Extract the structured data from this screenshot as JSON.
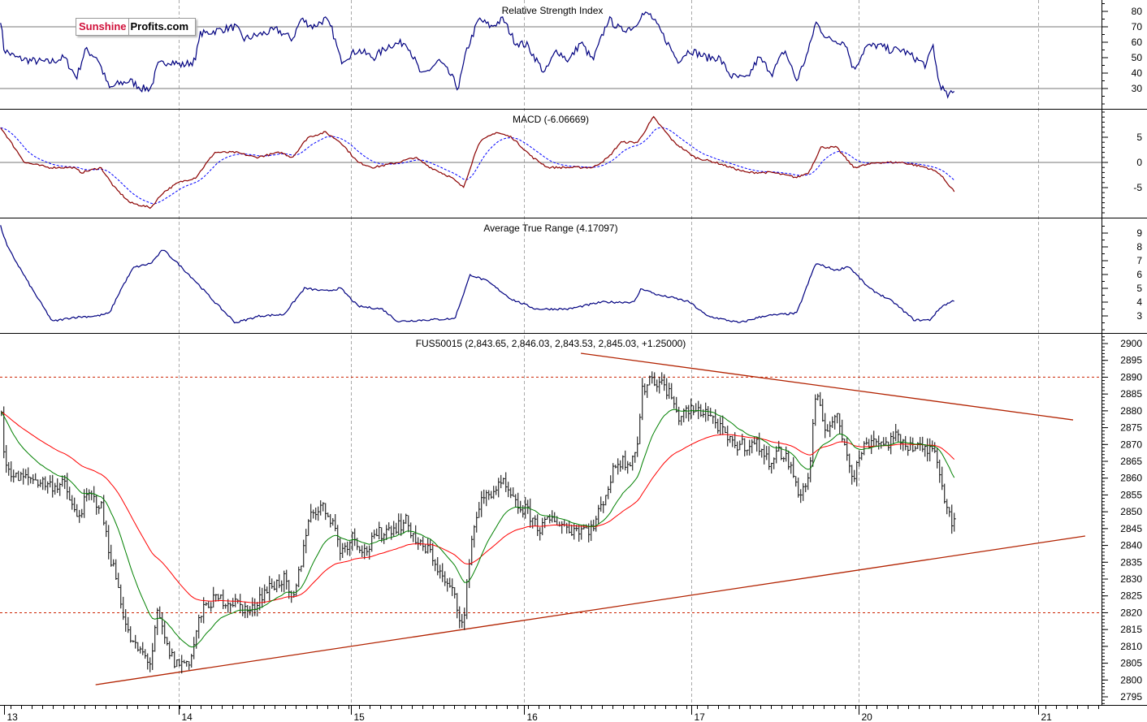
{
  "logo": {
    "part1": "Sunshine",
    "part2": "Profits.com"
  },
  "colors": {
    "price": "#000000",
    "ma_fast": "#008000",
    "ma_slow": "#ff0000",
    "indicator": "#000080",
    "macd": "#8b0000",
    "signal": "#0000ff",
    "trendline": "#b22200",
    "level": "#cc2200",
    "grid": "#aaaaaa"
  },
  "chart_data": [
    {
      "type": "line",
      "title": "Relative Strength Index",
      "ylim": [
        20,
        85
      ],
      "yticks": [
        80,
        70,
        60,
        50,
        40,
        30
      ],
      "reference_lines": [
        70,
        30
      ],
      "points": [
        [
          -0.02,
          75
        ],
        [
          0,
          55
        ],
        [
          0.07,
          50
        ],
        [
          0.16,
          48
        ],
        [
          0.26,
          47
        ],
        [
          0.35,
          50
        ],
        [
          0.42,
          37
        ],
        [
          0.47,
          55
        ],
        [
          0.54,
          50
        ],
        [
          0.61,
          30
        ],
        [
          0.66,
          33
        ],
        [
          0.73,
          35
        ],
        [
          0.8,
          30
        ],
        [
          0.85,
          30
        ],
        [
          0.89,
          45
        ],
        [
          0.96,
          48
        ],
        [
          1.03,
          45
        ],
        [
          1.11,
          48
        ],
        [
          1.13,
          65
        ],
        [
          1.25,
          68
        ],
        [
          1.34,
          70
        ],
        [
          1.39,
          62
        ],
        [
          1.48,
          65
        ],
        [
          1.58,
          68
        ],
        [
          1.67,
          62
        ],
        [
          1.72,
          75
        ],
        [
          1.79,
          70
        ],
        [
          1.86,
          75
        ],
        [
          1.9,
          68
        ],
        [
          1.95,
          48
        ],
        [
          2.05,
          55
        ],
        [
          2.14,
          50
        ],
        [
          2.23,
          58
        ],
        [
          2.33,
          60
        ],
        [
          2.38,
          48
        ],
        [
          2.42,
          38
        ],
        [
          2.52,
          48
        ],
        [
          2.59,
          38
        ],
        [
          2.63,
          30
        ],
        [
          2.68,
          55
        ],
        [
          2.75,
          75
        ],
        [
          2.82,
          70
        ],
        [
          2.89,
          75
        ],
        [
          2.96,
          60
        ],
        [
          3.03,
          58
        ],
        [
          3.13,
          40
        ],
        [
          3.2,
          55
        ],
        [
          3.27,
          48
        ],
        [
          3.34,
          60
        ],
        [
          3.41,
          48
        ],
        [
          3.5,
          75
        ],
        [
          3.57,
          68
        ],
        [
          3.65,
          70
        ],
        [
          3.69,
          78
        ],
        [
          3.74,
          78
        ],
        [
          3.83,
          62
        ],
        [
          3.9,
          48
        ],
        [
          3.97,
          55
        ],
        [
          4.07,
          50
        ],
        [
          4.14,
          50
        ],
        [
          4.21,
          38
        ],
        [
          4.3,
          36
        ],
        [
          4.37,
          50
        ],
        [
          4.45,
          40
        ],
        [
          4.52,
          55
        ],
        [
          4.59,
          35
        ],
        [
          4.66,
          55
        ],
        [
          4.7,
          73
        ],
        [
          4.77,
          62
        ],
        [
          4.87,
          60
        ],
        [
          4.92,
          42
        ],
        [
          4.99,
          57
        ],
        [
          5.06,
          58
        ],
        [
          5.13,
          55
        ],
        [
          5.2,
          55
        ],
        [
          5.27,
          50
        ],
        [
          5.34,
          45
        ],
        [
          5.38,
          58
        ],
        [
          5.41,
          35
        ],
        [
          5.46,
          25
        ],
        [
          5.51,
          28
        ]
      ]
    },
    {
      "type": "line",
      "title": "MACD (-6.06669)",
      "ylim": [
        -10,
        10
      ],
      "yticks": [
        5,
        0,
        -5
      ],
      "reference_lines": [
        0
      ],
      "series": [
        {
          "name": "MACD"
        },
        {
          "name": "Signal"
        }
      ],
      "points": [
        [
          -0.02,
          7
        ],
        [
          0.02,
          5
        ],
        [
          0.12,
          0
        ],
        [
          0.26,
          -1
        ],
        [
          0.4,
          -1
        ],
        [
          0.45,
          -2
        ],
        [
          0.56,
          -1
        ],
        [
          0.64,
          -5
        ],
        [
          0.73,
          -8
        ],
        [
          0.85,
          -9
        ],
        [
          0.92,
          -6
        ],
        [
          1.01,
          -4
        ],
        [
          1.11,
          -3
        ],
        [
          1.22,
          2
        ],
        [
          1.34,
          2
        ],
        [
          1.46,
          1
        ],
        [
          1.6,
          2
        ],
        [
          1.67,
          1
        ],
        [
          1.76,
          5
        ],
        [
          1.86,
          6
        ],
        [
          1.95,
          4
        ],
        [
          2.05,
          0
        ],
        [
          2.14,
          -1
        ],
        [
          2.28,
          0
        ],
        [
          2.38,
          1
        ],
        [
          2.47,
          -1
        ],
        [
          2.59,
          -3
        ],
        [
          2.66,
          -5
        ],
        [
          2.75,
          4
        ],
        [
          2.85,
          6
        ],
        [
          2.94,
          5
        ],
        [
          3.06,
          1
        ],
        [
          3.15,
          -1
        ],
        [
          3.27,
          -1
        ],
        [
          3.41,
          -1
        ],
        [
          3.5,
          1
        ],
        [
          3.57,
          4
        ],
        [
          3.67,
          4
        ],
        [
          3.76,
          9
        ],
        [
          3.88,
          4
        ],
        [
          4.0,
          1
        ],
        [
          4.12,
          0
        ],
        [
          4.21,
          -1
        ],
        [
          4.3,
          -2
        ],
        [
          4.45,
          -2
        ],
        [
          4.59,
          -3
        ],
        [
          4.66,
          -2
        ],
        [
          4.73,
          3
        ],
        [
          4.82,
          3
        ],
        [
          4.92,
          -1
        ],
        [
          5.06,
          0
        ],
        [
          5.2,
          0
        ],
        [
          5.34,
          -1
        ],
        [
          5.41,
          -2
        ],
        [
          5.46,
          -4
        ],
        [
          5.51,
          -6.07
        ]
      ]
    },
    {
      "type": "line",
      "title": "Average True Range (4.17097)",
      "ylim": [
        2,
        10
      ],
      "yticks": [
        9,
        8,
        7,
        6,
        5,
        4,
        3
      ],
      "points": [
        [
          -0.02,
          9.5
        ],
        [
          0.02,
          8
        ],
        [
          0.16,
          5
        ],
        [
          0.28,
          2.6
        ],
        [
          0.4,
          2.9
        ],
        [
          0.54,
          3.0
        ],
        [
          0.61,
          3.2
        ],
        [
          0.68,
          5
        ],
        [
          0.75,
          6.5
        ],
        [
          0.85,
          6.8
        ],
        [
          0.92,
          7.8
        ],
        [
          0.99,
          7
        ],
        [
          1.11,
          5.5
        ],
        [
          1.22,
          4
        ],
        [
          1.34,
          2.5
        ],
        [
          1.48,
          3
        ],
        [
          1.62,
          3.1
        ],
        [
          1.74,
          5
        ],
        [
          1.86,
          4.8
        ],
        [
          1.95,
          5
        ],
        [
          2.05,
          3.7
        ],
        [
          2.19,
          3.5
        ],
        [
          2.28,
          2.6
        ],
        [
          2.42,
          2.7
        ],
        [
          2.61,
          2.8
        ],
        [
          2.7,
          6
        ],
        [
          2.8,
          5.5
        ],
        [
          2.94,
          4.2
        ],
        [
          3.08,
          3.5
        ],
        [
          3.27,
          3.5
        ],
        [
          3.46,
          4.0
        ],
        [
          3.65,
          4.0
        ],
        [
          3.69,
          5
        ],
        [
          3.79,
          4.5
        ],
        [
          3.88,
          4.3
        ],
        [
          3.97,
          4.0
        ],
        [
          4.07,
          3.0
        ],
        [
          4.26,
          2.5
        ],
        [
          4.4,
          3.0
        ],
        [
          4.59,
          3.2
        ],
        [
          4.7,
          6.8
        ],
        [
          4.82,
          6.3
        ],
        [
          4.89,
          6.6
        ],
        [
          5.01,
          5.0
        ],
        [
          5.15,
          4
        ],
        [
          5.27,
          2.7
        ],
        [
          5.36,
          2.7
        ],
        [
          5.43,
          3.7
        ],
        [
          5.51,
          4.17
        ]
      ]
    },
    {
      "type": "bar",
      "subtype": "ohlc",
      "title": "FUS50015 (2,843.65, 2,846.03, 2,843.53, 2,845.03, +1.25000)",
      "ylim": [
        2792,
        2903
      ],
      "yticks": [
        2900,
        2895,
        2890,
        2885,
        2880,
        2875,
        2870,
        2865,
        2860,
        2855,
        2850,
        2845,
        2840,
        2835,
        2830,
        2825,
        2820,
        2815,
        2810,
        2805,
        2800,
        2795
      ],
      "horizontal_levels": [
        2890,
        2820
      ],
      "trendlines": [
        {
          "name": "resistance",
          "from": [
            3.34,
            2897.1
          ],
          "to": [
            6.19,
            2877.3
          ]
        },
        {
          "name": "support",
          "from": [
            0.53,
            2798.6
          ],
          "to": [
            6.26,
            2842.8
          ]
        }
      ],
      "moving_averages": [
        {
          "name": "fast",
          "color": "green"
        },
        {
          "name": "slow",
          "color": "red"
        }
      ],
      "close_points": [
        [
          -0.02,
          2885
        ],
        [
          0,
          2865
        ],
        [
          0.07,
          2860
        ],
        [
          0.16,
          2860
        ],
        [
          0.26,
          2858
        ],
        [
          0.35,
          2858
        ],
        [
          0.42,
          2848
        ],
        [
          0.49,
          2855
        ],
        [
          0.56,
          2852
        ],
        [
          0.61,
          2838
        ],
        [
          0.66,
          2828
        ],
        [
          0.71,
          2815
        ],
        [
          0.75,
          2810
        ],
        [
          0.8,
          2808
        ],
        [
          0.85,
          2805
        ],
        [
          0.89,
          2820
        ],
        [
          0.94,
          2810
        ],
        [
          0.99,
          2805
        ],
        [
          1.03,
          2805
        ],
        [
          1.08,
          2806
        ],
        [
          1.13,
          2818
        ],
        [
          1.18,
          2823
        ],
        [
          1.25,
          2824
        ],
        [
          1.34,
          2823
        ],
        [
          1.43,
          2820
        ],
        [
          1.48,
          2825
        ],
        [
          1.55,
          2828
        ],
        [
          1.62,
          2830
        ],
        [
          1.67,
          2822
        ],
        [
          1.72,
          2835
        ],
        [
          1.76,
          2848
        ],
        [
          1.83,
          2852
        ],
        [
          1.9,
          2848
        ],
        [
          1.95,
          2838
        ],
        [
          2.02,
          2843
        ],
        [
          2.09,
          2838
        ],
        [
          2.16,
          2843
        ],
        [
          2.23,
          2845
        ],
        [
          2.33,
          2847
        ],
        [
          2.4,
          2840
        ],
        [
          2.47,
          2838
        ],
        [
          2.54,
          2830
        ],
        [
          2.61,
          2825
        ],
        [
          2.66,
          2815
        ],
        [
          2.7,
          2840
        ],
        [
          2.75,
          2852
        ],
        [
          2.82,
          2856
        ],
        [
          2.89,
          2858
        ],
        [
          2.96,
          2852
        ],
        [
          3.03,
          2850
        ],
        [
          3.1,
          2845
        ],
        [
          3.18,
          2848
        ],
        [
          3.27,
          2845
        ],
        [
          3.34,
          2845
        ],
        [
          3.41,
          2845
        ],
        [
          3.48,
          2855
        ],
        [
          3.55,
          2865
        ],
        [
          3.62,
          2865
        ],
        [
          3.67,
          2870
        ],
        [
          3.69,
          2885
        ],
        [
          3.74,
          2890
        ],
        [
          3.81,
          2888
        ],
        [
          3.86,
          2885
        ],
        [
          3.9,
          2878
        ],
        [
          3.97,
          2880
        ],
        [
          4.07,
          2880
        ],
        [
          4.14,
          2875
        ],
        [
          4.21,
          2870
        ],
        [
          4.3,
          2870
        ],
        [
          4.37,
          2870
        ],
        [
          4.42,
          2865
        ],
        [
          4.49,
          2868
        ],
        [
          4.54,
          2865
        ],
        [
          4.61,
          2855
        ],
        [
          4.66,
          2860
        ],
        [
          4.7,
          2885
        ],
        [
          4.75,
          2875
        ],
        [
          4.82,
          2878
        ],
        [
          4.87,
          2870
        ],
        [
          4.92,
          2860
        ],
        [
          4.96,
          2868
        ],
        [
          5.03,
          2872
        ],
        [
          5.1,
          2870
        ],
        [
          5.17,
          2872
        ],
        [
          5.24,
          2870
        ],
        [
          5.34,
          2868
        ],
        [
          5.39,
          2870
        ],
        [
          5.43,
          2858
        ],
        [
          5.47,
          2850
        ],
        [
          5.51,
          2845
        ]
      ]
    }
  ],
  "x_axis": {
    "ticks": [
      {
        "t": 0,
        "label": "13"
      },
      {
        "t": 1.01,
        "label": "14"
      },
      {
        "t": 2.01,
        "label": "15"
      },
      {
        "t": 3.01,
        "label": "16"
      },
      {
        "t": 3.98,
        "label": "17"
      },
      {
        "t": 4.95,
        "label": "20"
      },
      {
        "t": 5.99,
        "label": "21"
      }
    ]
  }
}
